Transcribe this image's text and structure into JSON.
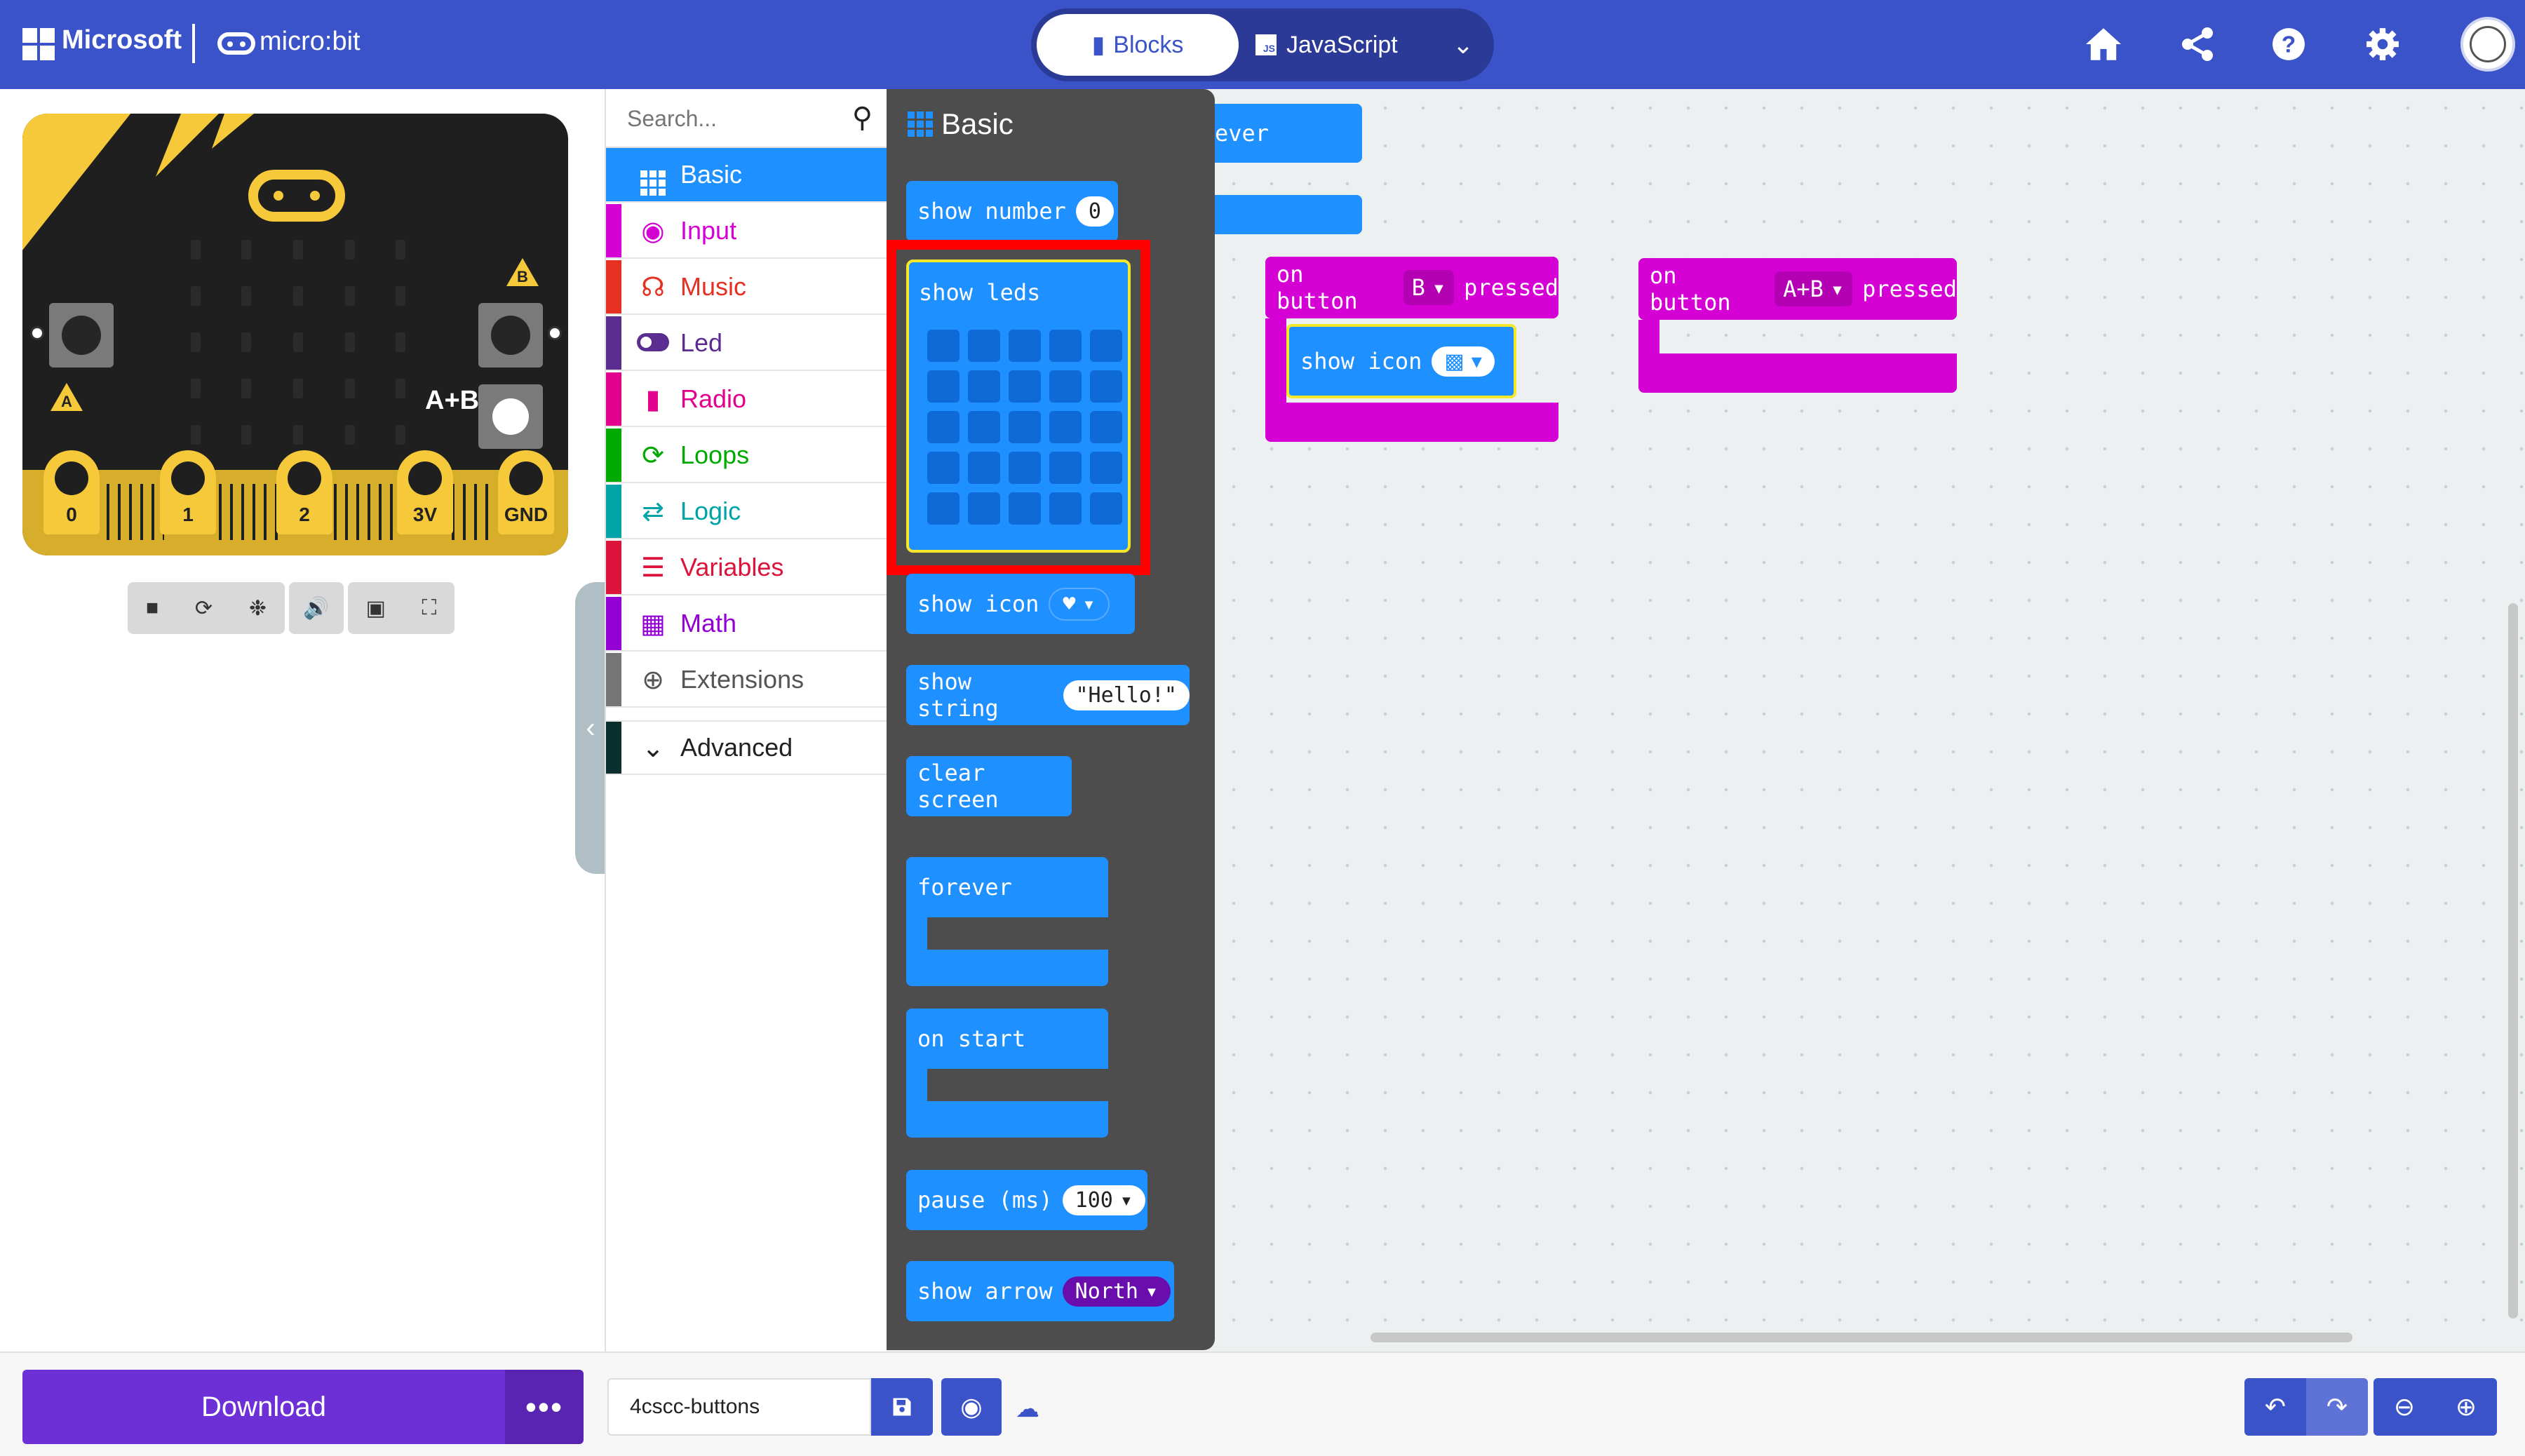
{
  "header": {
    "brand": "Microsoft",
    "product": "micro:bit",
    "tabs": [
      {
        "label": "Blocks",
        "active": true
      },
      {
        "label": "JavaScript",
        "active": false
      }
    ]
  },
  "simulator": {
    "button_a": "A",
    "button_b": "B",
    "button_ab": "A+B",
    "pins": [
      "0",
      "1",
      "2",
      "3V",
      "GND"
    ],
    "tools": [
      "stop-icon",
      "restart-icon",
      "debug-icon",
      "sound-icon",
      "screenshot-icon",
      "fullscreen-icon"
    ]
  },
  "toolbox": {
    "search_placeholder": "Search...",
    "categories": [
      {
        "label": "Basic",
        "color": "#1e90ff",
        "icon": "grid-icon"
      },
      {
        "label": "Input",
        "color": "#d400d4",
        "icon": "input-icon"
      },
      {
        "label": "Music",
        "color": "#e63022",
        "icon": "headphones-icon"
      },
      {
        "label": "Led",
        "color": "#5c2d91",
        "icon": "toggle-icon"
      },
      {
        "label": "Radio",
        "color": "#e3008c",
        "icon": "signal-icon"
      },
      {
        "label": "Loops",
        "color": "#00aa00",
        "icon": "loop-icon"
      },
      {
        "label": "Logic",
        "color": "#00a4a6",
        "icon": "shuffle-icon"
      },
      {
        "label": "Variables",
        "color": "#dc143c",
        "icon": "lines-icon"
      },
      {
        "label": "Math",
        "color": "#9400d3",
        "icon": "calculator-icon"
      },
      {
        "label": "Extensions",
        "color": "#757575",
        "icon": "plus-circle-icon"
      },
      {
        "label": "Advanced",
        "color": "#0b2f2f",
        "icon": "chevron-down-icon"
      }
    ]
  },
  "flyout": {
    "title": "Basic",
    "blocks": {
      "show_number": "show number",
      "show_number_value": "0",
      "show_leds": "show leds",
      "show_icon": "show icon",
      "show_string": "show string",
      "show_string_value": "\"Hello!\"",
      "clear_screen": "clear screen",
      "forever": "forever",
      "on_start": "on start",
      "pause": "pause (ms)",
      "pause_value": "100",
      "show_arrow": "show arrow",
      "show_arrow_value": "North"
    }
  },
  "workspace": {
    "partial_block": "ever",
    "on_button_b": {
      "prefix": "on button",
      "button": "B",
      "suffix": "pressed",
      "inner": "show icon"
    },
    "on_button_ab": {
      "prefix": "on button",
      "button": "A+B",
      "suffix": "pressed"
    }
  },
  "bottom": {
    "download": "Download",
    "more": "•••",
    "project_name": "4cscc-buttons"
  },
  "colors": {
    "header": "#3b53c9",
    "basic": "#1e90ff",
    "input": "#d400d4",
    "download": "#6d2fd6",
    "highlight": "#ff0000"
  }
}
